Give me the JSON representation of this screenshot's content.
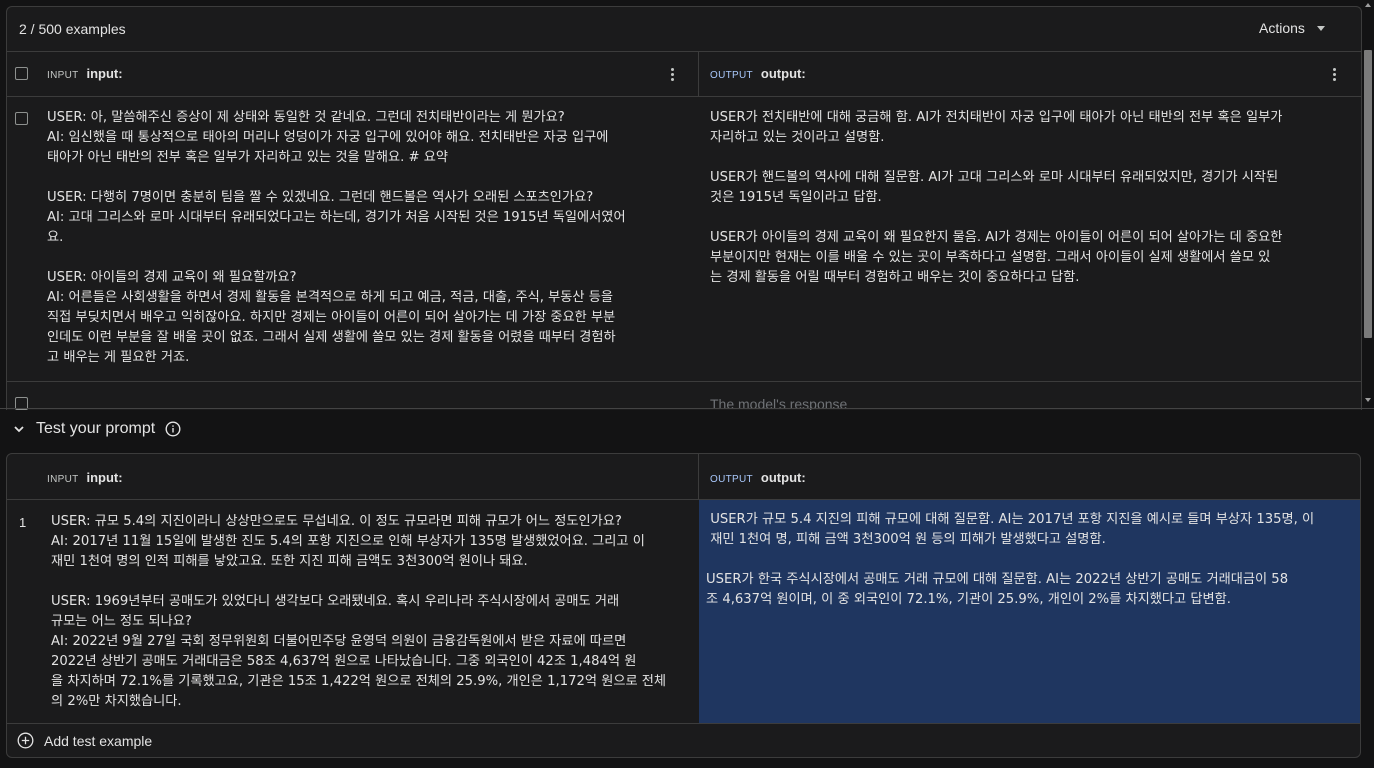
{
  "top_panel": {
    "count_label": "2 / 500 examples",
    "actions_label": "Actions",
    "input_tag": "INPUT",
    "input_col": "input:",
    "output_tag": "OUTPUT",
    "output_col": "output:",
    "rows": [
      {
        "input": "USER: 아, 말씀해주신 증상이 제 상태와 동일한 것 같네요. 그런데 전치태반이라는 게 뭔가요?\nAI: 임신했을 때 통상적으로 태아의 머리나 엉덩이가 자궁 입구에 있어야 해요. 전치태반은 자궁 입구에\n태아가 아닌 태반의 전부 혹은 일부가 자리하고 있는 것을 말해요. # 요약\n\nUSER: 다행히 7명이면 충분히 팀을 짤 수 있겠네요. 그런데 핸드볼은 역사가 오래된 스포츠인가요?\nAI: 고대 그리스와 로마 시대부터 유래되었다고는 하는데, 경기가 처음 시작된 것은 1915년 독일에서였어\n요.\n\nUSER: 아이들의 경제 교육이 왜 필요할까요?\nAI: 어른들은 사회생활을 하면서 경제 활동을 본격적으로 하게 되고 예금, 적금, 대출, 주식, 부동산 등을\n직접 부딪치면서 배우고 익히잖아요. 하지만 경제는 아이들이 어른이 되어 살아가는 데 가장 중요한 부분\n인데도 이런 부분을 잘 배울 곳이 없죠. 그래서 실제 생활에 쓸모 있는 경제 활동을 어렸을 때부터 경험하\n고 배우는 게 필요한 거죠.",
        "output": "USER가 전치태반에 대해 궁금해 함. AI가 전치태반이 자궁 입구에 태아가 아닌 태반의 전부 혹은 일부가\n자리하고 있는 것이라고 설명함.\n\nUSER가 핸드볼의 역사에 대해 질문함. AI가 고대 그리스와 로마 시대부터 유래되었지만, 경기가 시작된\n것은 1915년 독일이라고 답함.\n\nUSER가 아이들의 경제 교육이 왜 필요한지 물음. AI가 경제는 아이들이 어른이 되어 살아가는 데 중요한\n부분이지만 현재는 이를 배울 수 있는 곳이 부족하다고 설명함. 그래서 아이들이 실제 생활에서 쓸모 있\n는 경제 활동을 어릴 때부터 경험하고 배우는 것이 중요하다고 답함."
      }
    ],
    "empty_output_placeholder": "The model's response"
  },
  "test_section": {
    "title": "Test your prompt",
    "input_tag": "INPUT",
    "input_col": "input:",
    "output_tag": "OUTPUT",
    "output_col": "output:",
    "row_number": "1",
    "input": "USER: 규모 5.4의 지진이라니 상상만으로도 무섭네요. 이 정도 규모라면 피해 규모가 어느 정도인가요?\nAI: 2017년 11월 15일에 발생한 진도 5.4의 포항 지진으로 인해 부상자가 135명 발생했었어요. 그리고 이\n재민 1천여 명의 인적 피해를 낳았고요. 또한 지진 피해 금액도 3천300억 원이나 돼요.\n\nUSER: 1969년부터 공매도가 있었다니 생각보다 오래됐네요. 혹시 우리나라 주식시장에서 공매도 거래\n규모는 어느 정도 되나요?\nAI: 2022년 9월 27일 국회 정무위원회 더불어민주당 윤영덕 의원이 금융감독원에서 받은 자료에 따르면\n2022년 상반기 공매도 거래대금은 58조 4,637억 원으로 나타났습니다. 그중 외국인이 42조 1,484억 원\n을 차지하며 72.1%를 기록했고요, 기관은 15조 1,422억 원으로 전체의 25.9%, 개인은 1,172억 원으로 전체\n의 2%만 차지했습니다.",
    "output": " USER가 규모 5.4 지진의 피해 규모에 대해 질문함. AI는 2017년 포항 지진을 예시로 들며 부상자 135명, 이\n 재민 1천여 명, 피해 금액 3천300억 원 등의 피해가 발생했다고 설명함.\n\nUSER가 한국 주식시장에서 공매도 거래 규모에 대해 질문함. AI는 2022년 상반기 공매도 거래대금이 58\n조 4,637억 원이며, 이 중 외국인이 72.1%, 기관이 25.9%, 개인이 2%를 차지했다고 답변함.",
    "add_label": "Add test example"
  },
  "colors": {
    "output_highlight": "#1f3660",
    "accent": "#a8c7fa"
  }
}
